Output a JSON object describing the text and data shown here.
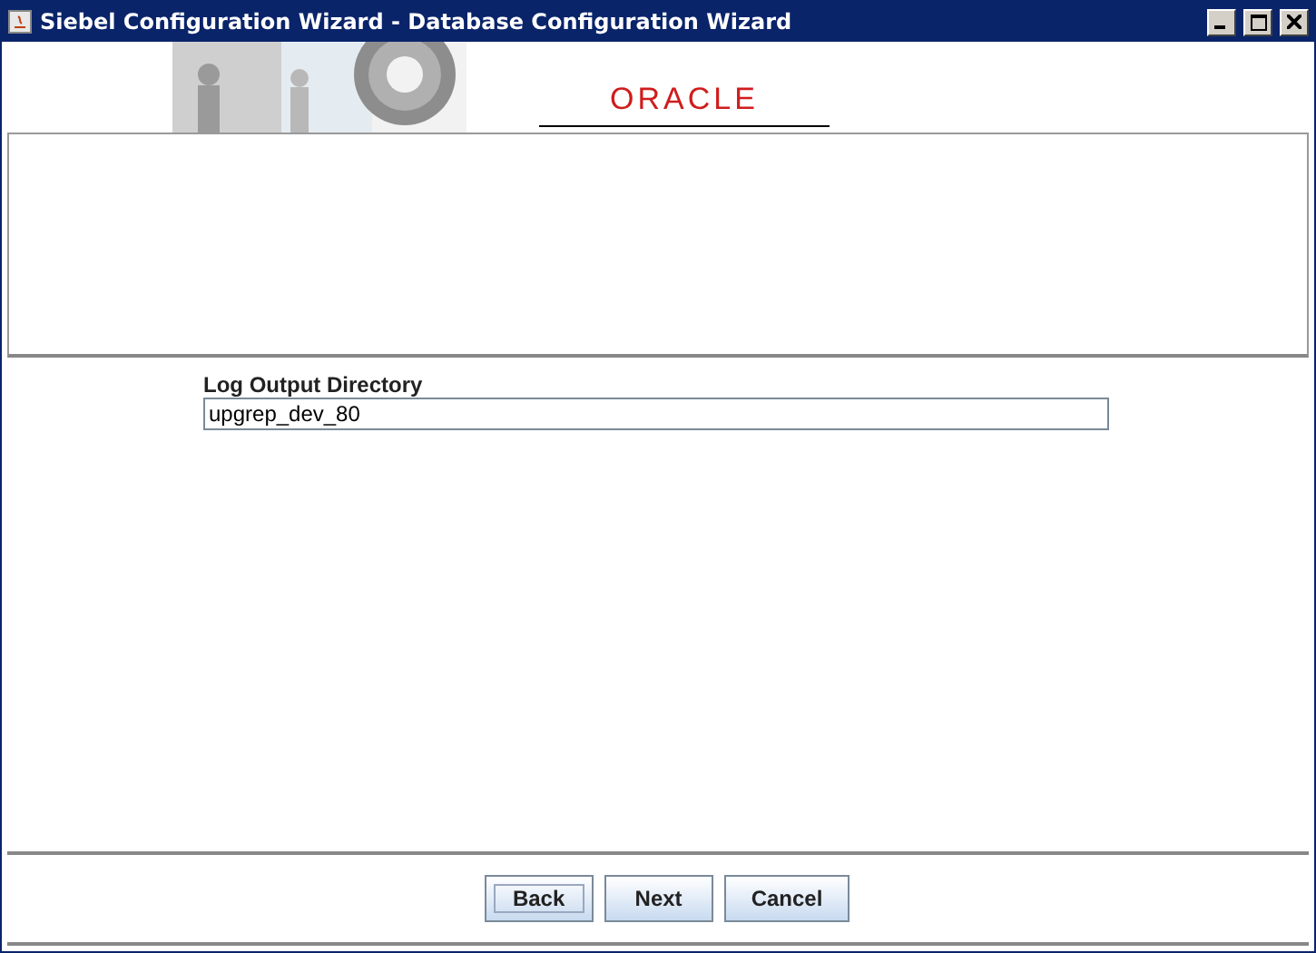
{
  "window": {
    "title": "Siebel Configuration Wizard - Database Configuration Wizard"
  },
  "banner": {
    "logo": "ORACLE"
  },
  "field": {
    "label": "Log Output Directory",
    "value": "upgrep_dev_80"
  },
  "buttons": [
    {
      "label": "Back",
      "focused": true
    },
    {
      "label": "Next",
      "focused": false
    },
    {
      "label": "Cancel",
      "focused": false
    }
  ]
}
